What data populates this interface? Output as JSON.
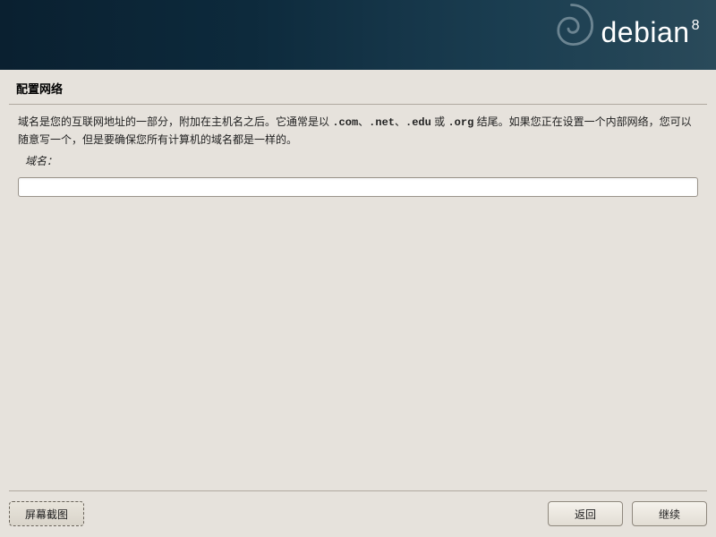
{
  "branding": {
    "name": "debian",
    "version": "8"
  },
  "page": {
    "title": "配置网络"
  },
  "description": {
    "before_examples": "域名是您的互联网地址的一部分，附加在主机名之后。它通常是以 ",
    "examples": [
      ".com",
      "、",
      ".net",
      "、",
      ".edu",
      " 或 ",
      ".org"
    ],
    "after_examples": " 结尾。如果您正在设置一个内部网络，您可以随意写一个，但是要确保您所有计算机的域名都是一样的。"
  },
  "field": {
    "label": "域名：",
    "value": ""
  },
  "buttons": {
    "screenshot": "屏幕截图",
    "back": "返回",
    "continue": "继续"
  }
}
